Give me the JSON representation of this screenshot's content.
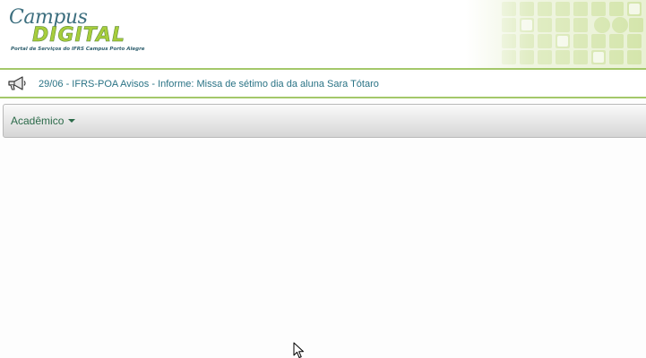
{
  "header": {
    "logo": {
      "script_text": "Campus",
      "brand_text": "DIGITAL",
      "subtitle": "Portal de Serviços do IFRS Campus Porto Alegre"
    }
  },
  "news": {
    "icon": "megaphone-icon",
    "text": "29/06 - IFRS-POA Avisos - Informe: Missa de sétimo dia da aluna Sara Tótaro"
  },
  "menu": {
    "items": [
      {
        "label": "Acadêmico",
        "icon": "caret-down-icon"
      }
    ]
  },
  "colors": {
    "accent_green": "#a4c86a",
    "logo_green": "#a7cd3c",
    "link_teal": "#2a7385",
    "menu_text": "#2b6a49"
  }
}
